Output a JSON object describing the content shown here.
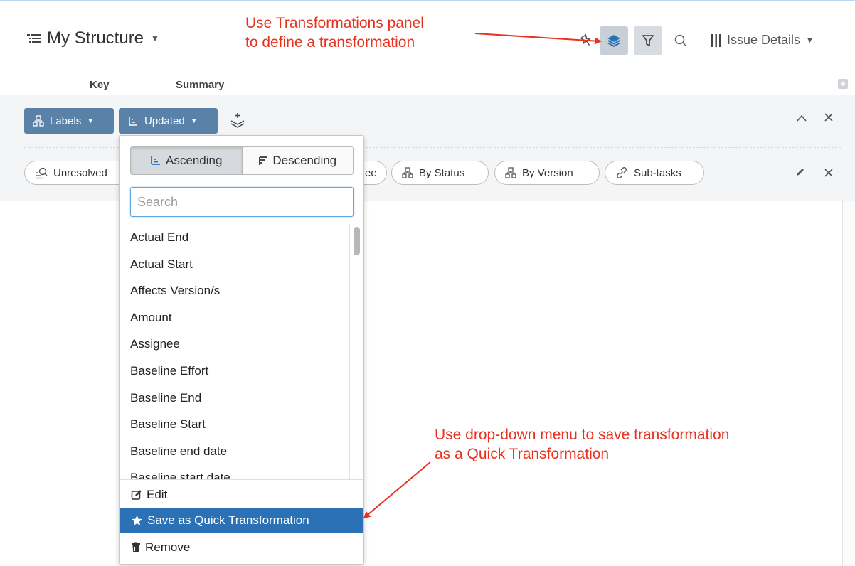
{
  "structure": {
    "title": "My Structure"
  },
  "toolbar": {
    "issue_details_label": "Issue Details"
  },
  "columns": {
    "key": "Key",
    "summary": "Summary"
  },
  "transform_panel": {
    "chips": [
      {
        "label": "Labels",
        "icon": "group-icon"
      },
      {
        "label": "Updated",
        "icon": "sort-icon"
      }
    ],
    "quick_transformations": [
      {
        "label": "Unresolved",
        "icon": "filter-search-icon"
      },
      {
        "label": "ee"
      },
      {
        "label": "By Status",
        "icon": "group-icon"
      },
      {
        "label": "By Version",
        "icon": "group-icon"
      },
      {
        "label": "Sub-tasks",
        "icon": "link-icon"
      }
    ]
  },
  "sort_dropdown": {
    "ascending_label": "Ascending",
    "descending_label": "Descending",
    "selected_order": "Ascending",
    "search_placeholder": "Search",
    "fields": [
      "Actual End",
      "Actual Start",
      "Affects Version/s",
      "Amount",
      "Assignee",
      "Baseline Effort",
      "Baseline End",
      "Baseline Start",
      "Baseline end date",
      "Baseline start date"
    ],
    "actions": {
      "edit": "Edit",
      "save_quick": "Save as Quick Transformation",
      "remove": "Remove"
    }
  },
  "annotations": {
    "top_line1": "Use Transformations panel",
    "top_line2": "to define a transformation",
    "bottom_line1": "Use drop-down menu to save transformation",
    "bottom_line2": "as a Quick Transformation"
  },
  "colors": {
    "accent": "#2a72b5",
    "chip": "#5a82a8",
    "annotation": "#e8321f"
  }
}
